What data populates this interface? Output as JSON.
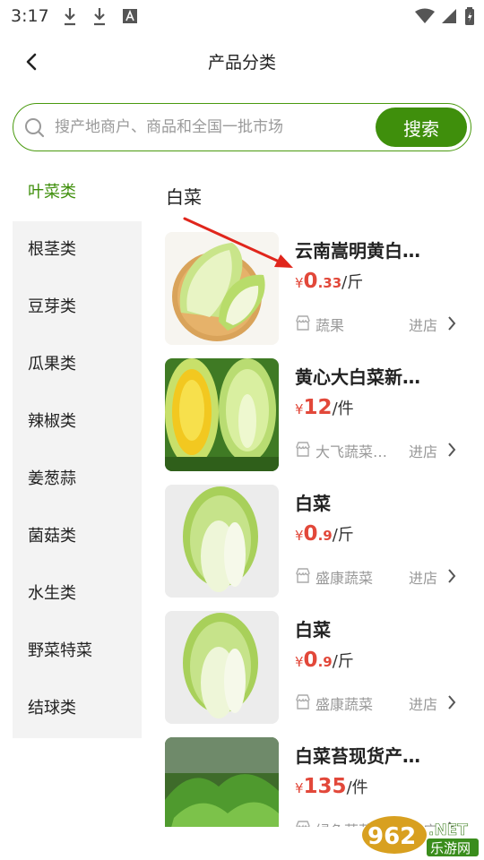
{
  "status_bar": {
    "time": "3:17"
  },
  "header": {
    "title": "产品分类"
  },
  "search": {
    "placeholder": "搜产地商户、商品和全国一批市场",
    "button_label": "搜索"
  },
  "categories": [
    "叶菜类",
    "根茎类",
    "豆芽类",
    "瓜果类",
    "辣椒类",
    "姜葱蒜",
    "菌菇类",
    "水生类",
    "野菜特菜",
    "结球类"
  ],
  "active_category": "叶菜类",
  "section_title": "白菜",
  "products": [
    {
      "name": "云南嵩明黄白…",
      "price_currency": "¥",
      "price_int": "0",
      "price_dec": ".33",
      "unit": "/斤",
      "shop": "蔬果",
      "enter_label": "进店"
    },
    {
      "name": "黄心大白菜新…",
      "price_currency": "¥",
      "price_int": "12",
      "price_dec": "",
      "unit": "/件",
      "shop": "大飞蔬菜…",
      "enter_label": "进店"
    },
    {
      "name": "白菜",
      "price_currency": "¥",
      "price_int": "0",
      "price_dec": ".9",
      "unit": "/斤",
      "shop": "盛康蔬菜",
      "enter_label": "进店"
    },
    {
      "name": "白菜",
      "price_currency": "¥",
      "price_int": "0",
      "price_dec": ".9",
      "unit": "/斤",
      "shop": "盛康蔬菜",
      "enter_label": "进店"
    },
    {
      "name": "白菜苔现货产…",
      "price_currency": "¥",
      "price_int": "135",
      "price_dec": "",
      "unit": "/件",
      "shop": "绿色蔬菜",
      "enter_label": "进店"
    }
  ],
  "watermark": {
    "number": "962",
    "domain": ".NET",
    "name": "乐游网"
  },
  "colors": {
    "accent": "#3f8f0c",
    "price": "#e2483a",
    "sidebar_bg": "#f3f3f3",
    "muted_text": "#999999"
  }
}
